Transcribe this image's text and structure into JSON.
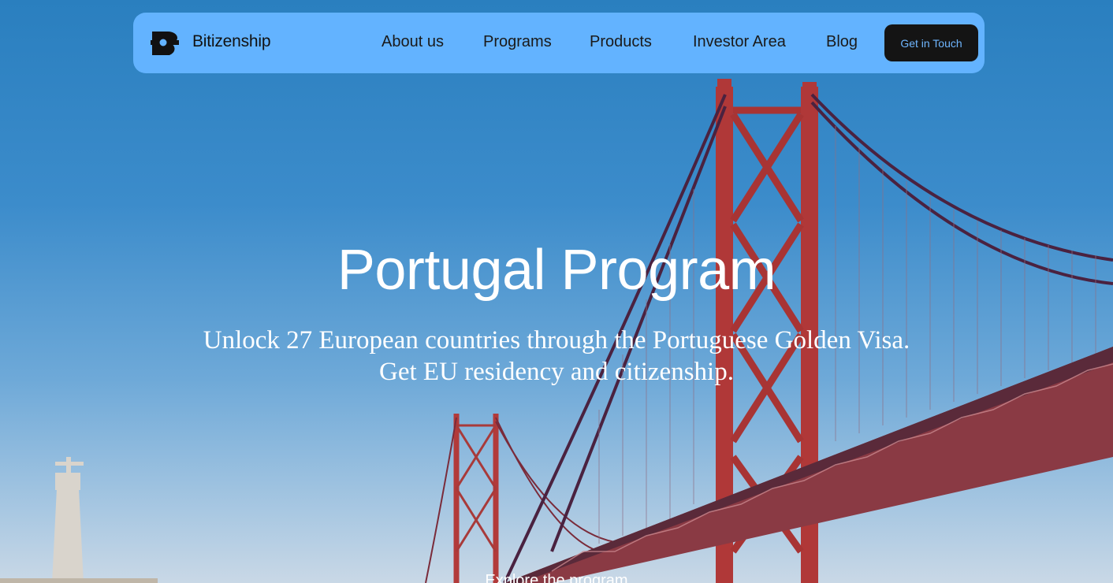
{
  "brand": {
    "name": "Bitizenship",
    "logo_icon": "bitizenship-logo-icon"
  },
  "nav": {
    "items": [
      {
        "label": "About us"
      },
      {
        "label": "Programs"
      },
      {
        "label": "Products"
      },
      {
        "label": "Investor Area"
      },
      {
        "label": "Blog"
      }
    ],
    "cta_label": "Get in Touch"
  },
  "hero": {
    "title": "Portugal Program",
    "subtitle": "Unlock 27 European countries through the Portuguese Golden Visa. Get EU residency and citizenship.",
    "explore_label": "Explore the program"
  },
  "colors": {
    "navbar_bg": "#63b3ff",
    "cta_bg": "#141414",
    "cta_text": "#6fb6ff",
    "bridge_red": "#a83a3a"
  }
}
